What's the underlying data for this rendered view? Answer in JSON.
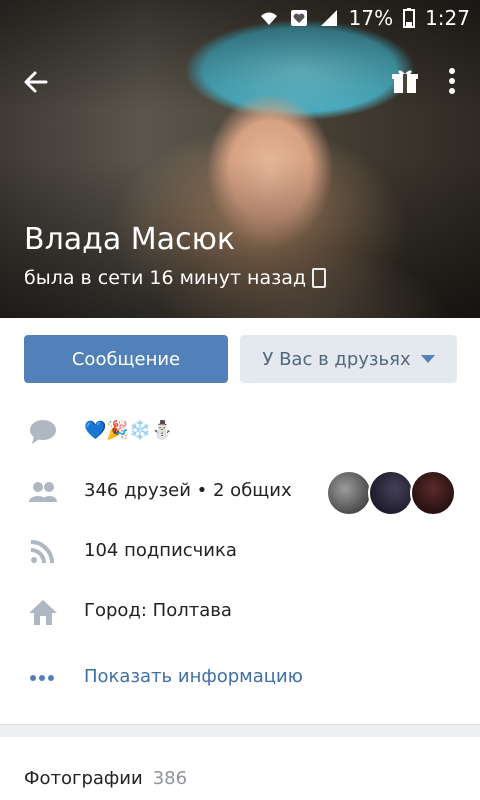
{
  "status": {
    "battery": "17%",
    "time": "1:27"
  },
  "profile": {
    "name": "Влада Масюк",
    "last_seen": "была в сети 16 минут назад"
  },
  "actions": {
    "message": "Сообщение",
    "friends": "У Вас в друзьях"
  },
  "info": {
    "status_text": "💙🎉❄️⛄",
    "friends": "346 друзей • 2 общих",
    "followers": "104 подписчика",
    "city": "Город: Полтава",
    "show_info": "Показать информацию"
  },
  "photos": {
    "label": "Фотографии",
    "count": "386"
  },
  "colors": {
    "accent": "#5181b8",
    "link": "#3f6fa7",
    "icon": "#aeb7c2"
  }
}
